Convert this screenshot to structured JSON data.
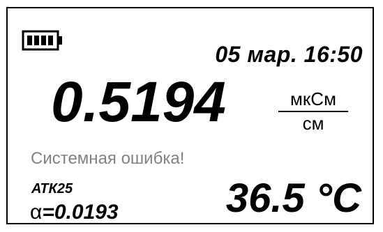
{
  "status": {
    "battery_icon": "battery-full-icon",
    "datetime": "05 мар. 16:50"
  },
  "measurement": {
    "value": "0.5194",
    "unit_numerator": "мкСм",
    "unit_denominator": "см"
  },
  "error": {
    "message": "Системная ошибка!"
  },
  "compensation": {
    "label": "АТК25",
    "coef_symbol": "α",
    "coef_value": "=0.0193"
  },
  "temperature": {
    "value": "36.5 °C"
  },
  "colors": {
    "foreground": "#000000",
    "background": "#ffffff",
    "error_text": "#828282"
  }
}
